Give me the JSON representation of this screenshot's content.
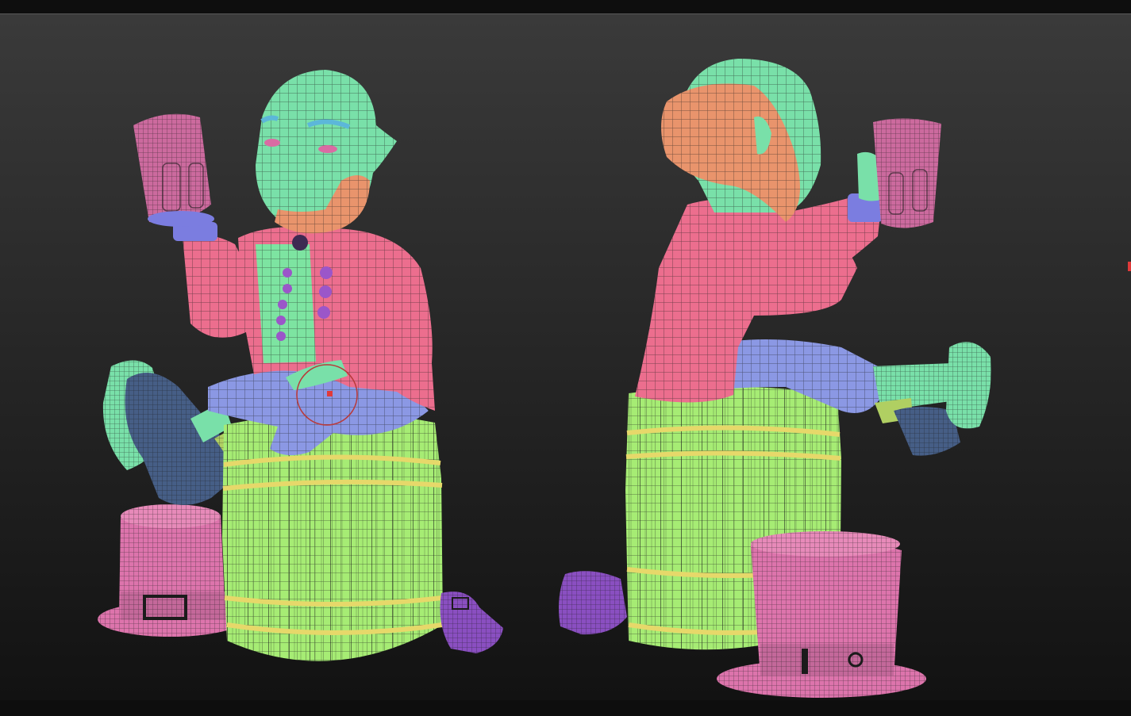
{
  "viewport": {
    "background_top": "#3a3a3a",
    "background_bottom": "#121212"
  },
  "palette": {
    "skin": "#79e0a9",
    "beard": "#e9946c",
    "coat": "#ec6e8e",
    "vest": "#7de4a1",
    "pants": "#8b98e4",
    "socks": "#b0cf62",
    "shoe": "#465e86",
    "barrel": "#a6ec74",
    "barrel_band": "#e6d86a",
    "hat": "#dd74ac",
    "mug": "#cc6a9e",
    "cuff": "#7b7de0",
    "buttons": "#9b56c9",
    "loose_shoes": "#8a4fc1",
    "wire": "#1b1b1b"
  },
  "icons": {
    "brush_cursor": "draw-size-circle-icon"
  }
}
